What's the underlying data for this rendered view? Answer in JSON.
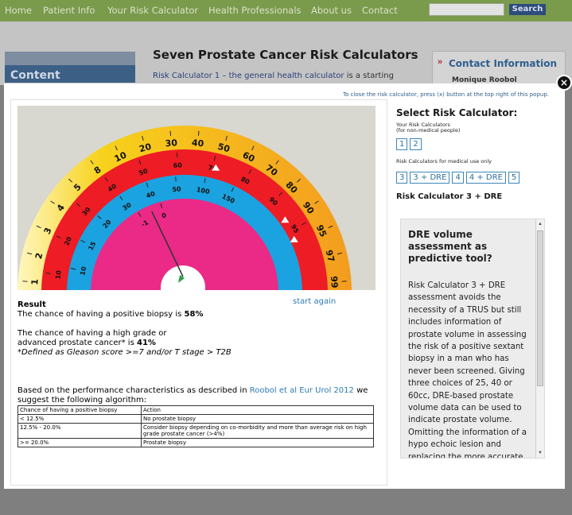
{
  "nav": {
    "items": [
      "Home",
      "Patient Info",
      "Your Risk Calculator",
      "Health Professionals",
      "About us",
      "Contact"
    ],
    "search_button": "Search"
  },
  "site": {
    "content_heading": "Content",
    "page_title": "Seven Prostate Cancer Risk Calculators",
    "intro_link": "Risk Calculator 1 – the general health calculator",
    "intro_rest": "is a starting",
    "contact_heading": "Contact Information",
    "contact_name": "Monique Roobol"
  },
  "modal": {
    "close_note": "To close the risk calculator, press (x) button at the top right of this popup.",
    "close_symbol": "×",
    "start_again": "start again",
    "result": {
      "heading": "Result",
      "line1_pre": "The chance of having a positive biopsy is ",
      "line1_value": "58%",
      "line2": "The chance of having a high grade or",
      "line3_pre": "advanced prostate cancer* is ",
      "line3_value": "41%",
      "footnote": "*Defined as Gleason score >=7 and/or T stage > T2B"
    },
    "algorithm": {
      "text_pre": "Based on the performance characteristics as described in ",
      "text_link": "Roobol et al Eur Urol 2012",
      "text_post": " we",
      "text_line2": "suggest the following algorithm:",
      "table": [
        [
          "Chance of having a positive biopsy",
          "Action"
        ],
        [
          "< 12.5%",
          "No prostate biopsy"
        ],
        [
          "12.5% - 20.0%",
          "Consider biopsy depending on co-morbidity and more than average risk on high grade prostate cancer (>4%)"
        ],
        [
          ">= 20.0%",
          "Prostate biopsy"
        ]
      ]
    },
    "selector": {
      "title": "Select Risk Calculator:",
      "group1_label1": "Your Risk Calculators",
      "group1_label2": "(for non-medical people)",
      "group1_buttons": [
        "1",
        "2"
      ],
      "group2_label": "Risk Calculators for medical use only",
      "group2_buttons": [
        "3",
        "3 + DRE",
        "4",
        "4 + DRE",
        "5"
      ],
      "current": "Risk Calculator 3 + DRE"
    },
    "info": {
      "heading": "DRE volume assessment as predictive tool?",
      "body": "Risk Calculator 3 + DRE assessment avoids the necessity of a TRUS but still includes information of prostate volume in assessing the risk of a positive sextant biopsy in a man who has never been screened. Giving three choices of 25, 40 or 60cc, DRE-based prostate volume data can be used to indicate prostate volume. Omitting the information of a hypo echoic lesion and replacing the more accurate TRUS assessed"
    },
    "dial": {
      "outer_scale": [
        "1",
        "2",
        "3",
        "4",
        "5",
        "8",
        "10",
        "20",
        "30",
        "40",
        "50",
        "60",
        "70",
        "80",
        "90",
        "95",
        "97",
        "99"
      ],
      "red_scale": [
        "10",
        "20",
        "30",
        "40",
        "50",
        "60",
        "70",
        "80",
        "90",
        "95"
      ],
      "blue_scale": [
        "10",
        "15",
        "20",
        "30",
        "40",
        "50",
        "100",
        "150"
      ],
      "pink_scale": [
        "-1",
        "0"
      ],
      "colors": {
        "yellow": "#f7d21c",
        "orange": "#f39c1f",
        "red": "#ee1c24",
        "blue": "#1ba2e0",
        "pink": "#ea2a86"
      }
    }
  }
}
